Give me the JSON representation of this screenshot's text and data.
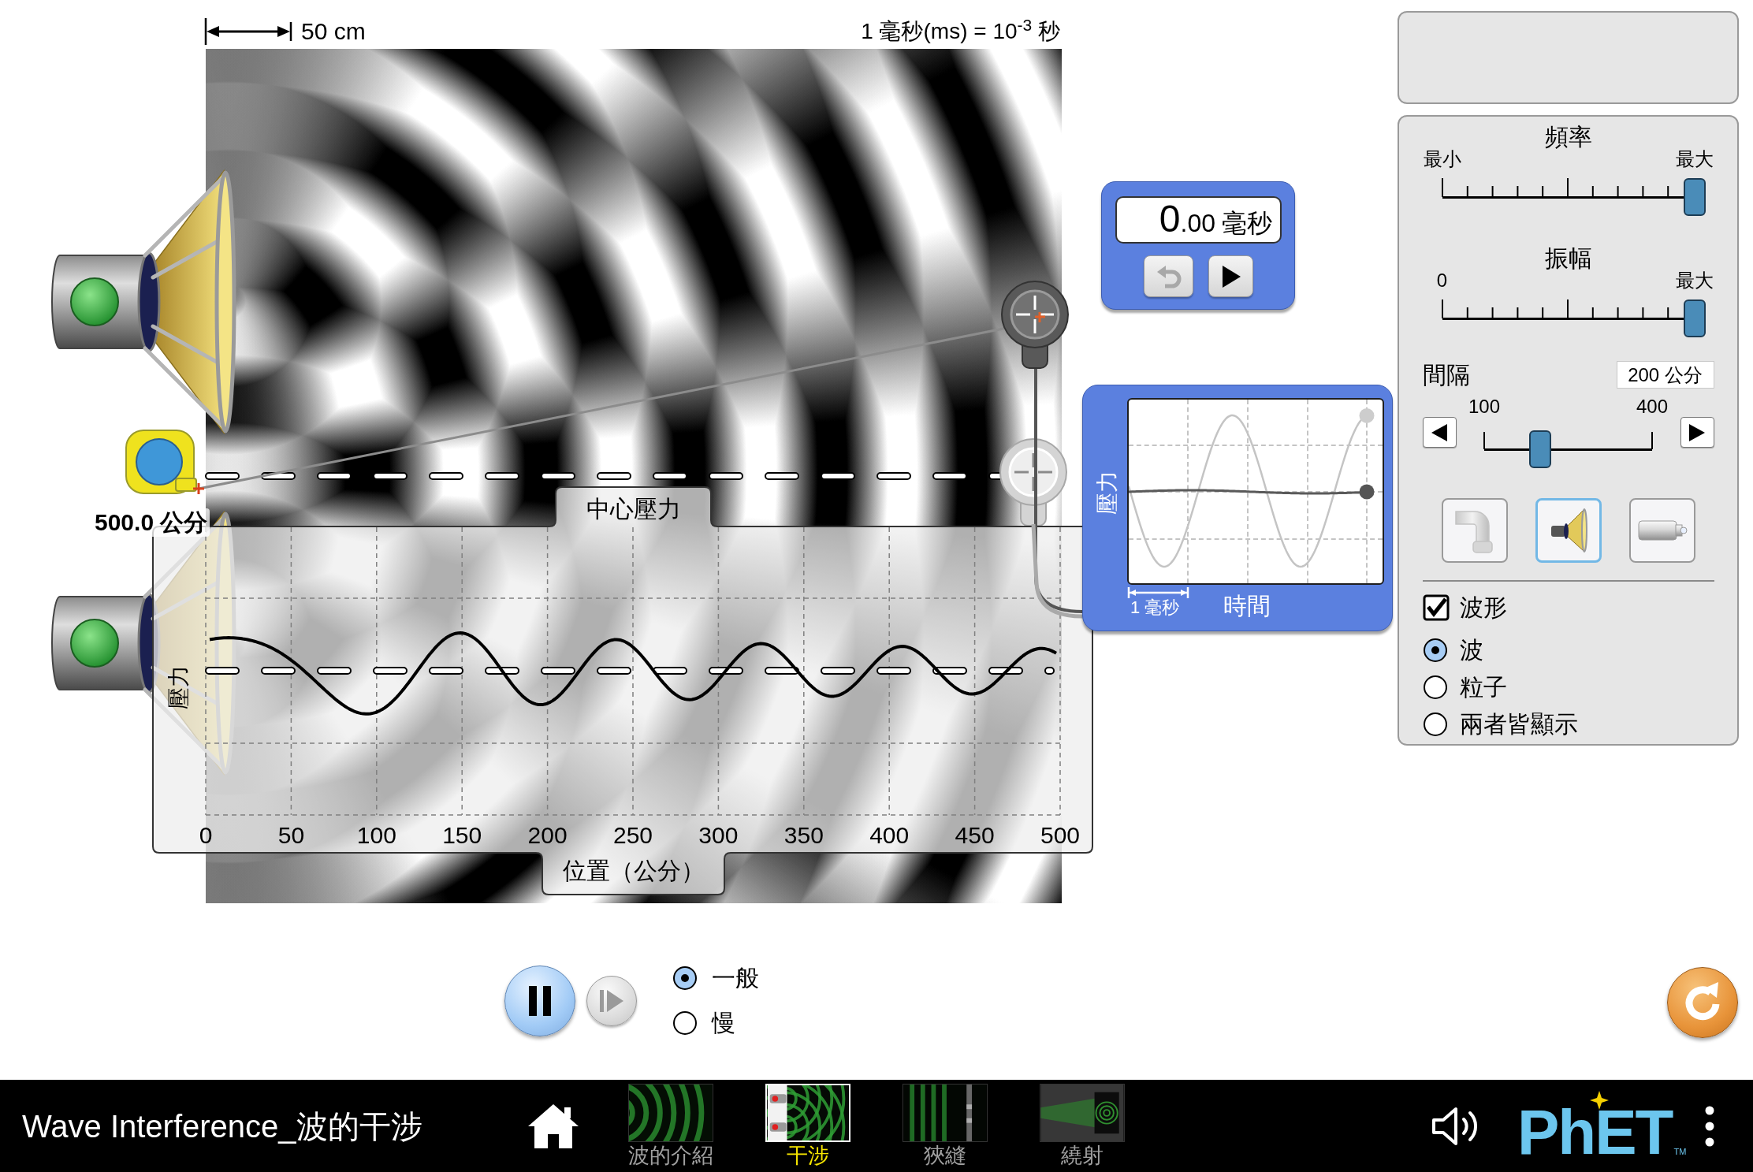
{
  "scale_bar": {
    "label": "50 cm"
  },
  "time_unit_note": "1 毫秒(ms) = 10$^{-3}$ 秒",
  "measuring_tape": {
    "reading": "500.0 公分"
  },
  "center_pressure_chart": {
    "title": "中心壓力",
    "ylabel": "壓力",
    "xlabel": "位置（公分）",
    "tick_labels": [
      "0",
      "50",
      "100",
      "150",
      "200",
      "250",
      "300",
      "350",
      "400",
      "450",
      "500"
    ]
  },
  "stopwatch": {
    "reading": "0.00",
    "unit": "毫秒",
    "buttons": [
      {
        "kind": "reset",
        "disabled": true
      },
      {
        "kind": "play",
        "disabled": false
      }
    ]
  },
  "time_chart": {
    "ylabel": "壓力",
    "scale_label": "1 毫秒",
    "xlabel": "時間"
  },
  "control_panel": {
    "frequency": {
      "title": "頻率",
      "min_label": "最小",
      "max_label": "最大",
      "level": 1
    },
    "amplitude": {
      "title": "振幅",
      "min_label": "0",
      "max_label": "最大",
      "level": 1
    },
    "separation": {
      "label": "間隔",
      "value": "200 公分",
      "min_label": "100",
      "max_label": "400",
      "level": 0.333
    },
    "sources": [
      {
        "kind": "water",
        "selected": false
      },
      {
        "kind": "sound",
        "selected": true
      },
      {
        "kind": "light",
        "selected": false
      }
    ],
    "waveform": {
      "label": "波形",
      "checked": true
    },
    "views": [
      {
        "label": "波",
        "selected": true
      },
      {
        "label": "粒子",
        "selected": false
      },
      {
        "label": "兩者皆顯示",
        "selected": false
      }
    ]
  },
  "playback": {
    "playing": true,
    "speeds": [
      {
        "label": "一般",
        "selected": true
      },
      {
        "label": "慢",
        "selected": false
      }
    ]
  },
  "nav_bar": {
    "title": "Wave Interference_波的干涉",
    "screens": [
      {
        "kind": "waves",
        "label": "波的介紹",
        "selected": false
      },
      {
        "kind": "interference",
        "label": "干涉",
        "selected": true
      },
      {
        "kind": "slits",
        "label": "狹縫",
        "selected": false
      },
      {
        "kind": "diffraction",
        "label": "繞射",
        "selected": false
      }
    ],
    "logo": {
      "text": "PhET",
      "mark": "TM"
    }
  }
}
